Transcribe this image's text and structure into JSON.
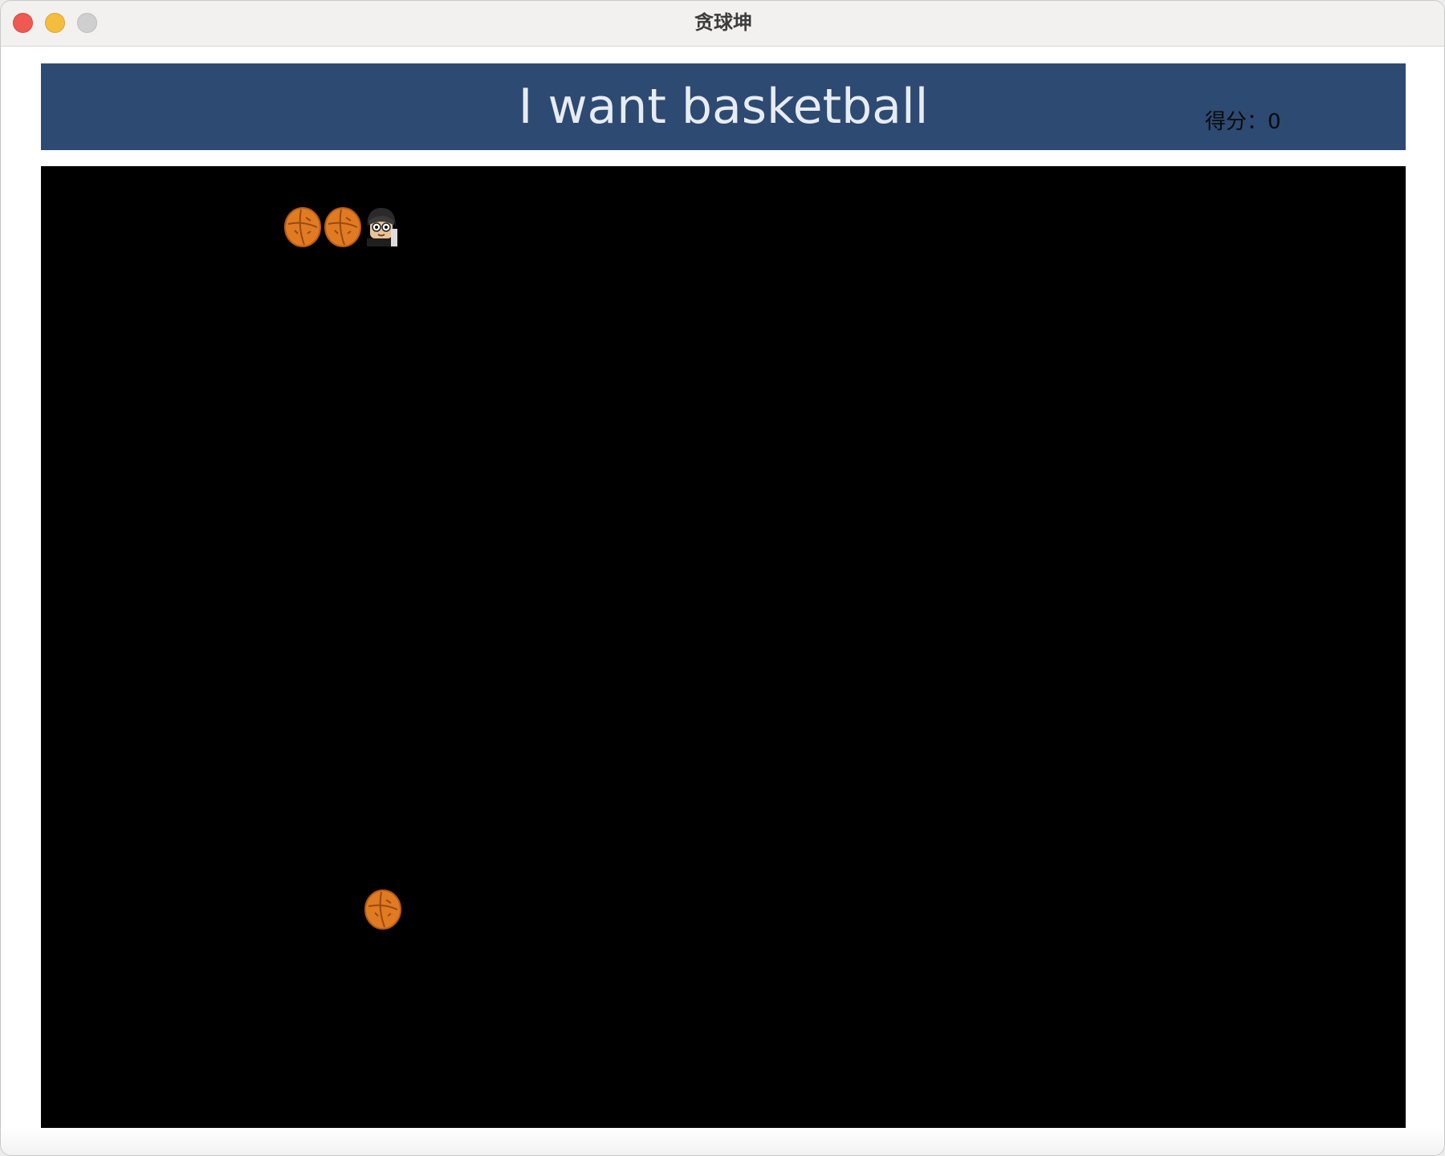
{
  "window": {
    "title": "贪球坤"
  },
  "header": {
    "title": "I want basketball",
    "score_text": "得分：0",
    "background_color": "#2d4a72"
  },
  "board": {
    "background_color": "#000000",
    "sprites": [
      {
        "kind": "basketball",
        "icon": "basketball-icon",
        "role": "snake-body"
      },
      {
        "kind": "basketball",
        "icon": "basketball-icon",
        "role": "snake-body"
      },
      {
        "kind": "player",
        "icon": "player-head-icon",
        "role": "snake-head"
      },
      {
        "kind": "basketball",
        "icon": "basketball-icon",
        "role": "food"
      }
    ]
  },
  "colors": {
    "ball_orange": "#e07b22",
    "ball_dark": "#9a4a10"
  }
}
